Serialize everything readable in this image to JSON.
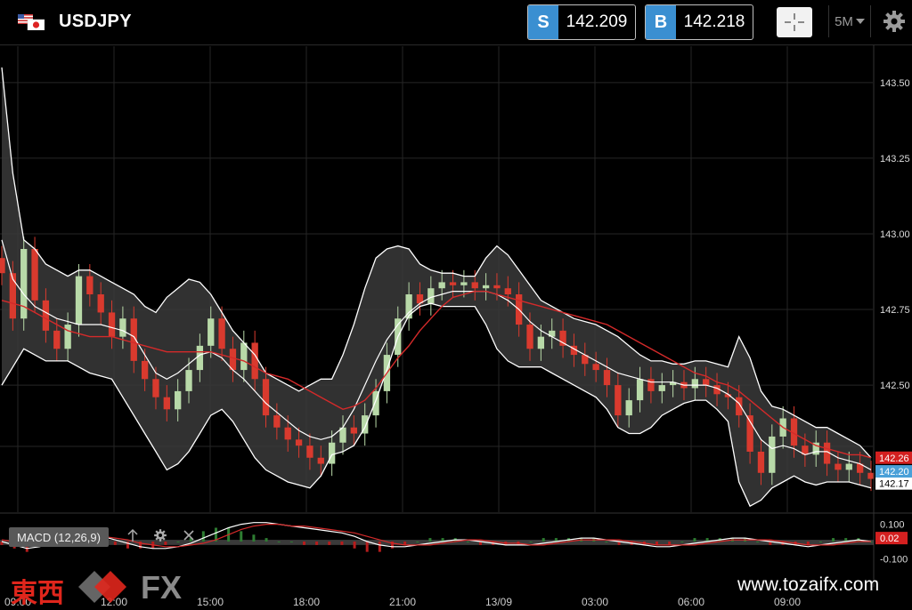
{
  "header": {
    "symbol": "USDJPY",
    "sell_tag": "S",
    "sell_price": "142.209",
    "buy_tag": "B",
    "buy_price": "142.218",
    "timeframe": "5M",
    "timeframe_icon": "caret-down-icon",
    "crosshair_icon": "crosshair-icon",
    "settings_icon": "gear-icon",
    "flag_icon": "us-japan-flag-icon"
  },
  "indicator": {
    "label": "MACD (12,26,9)",
    "up_icon": "arrow-up-icon",
    "settings_icon": "gear-icon",
    "close_icon": "close-icon"
  },
  "branding": {
    "logo_text": "東西",
    "logo_fx": "FX",
    "website": "www.tozaifx.com"
  },
  "colors": {
    "background": "#000000",
    "band_fill": "#3a3a3a",
    "band_line": "#ffffff",
    "ma_line": "#d42a2a",
    "bull_candle": "#b8d9a8",
    "bear_candle": "#d93a2e",
    "sell_badge": "#3a8fd1",
    "last_price_red": "#d42020",
    "last_price_blue": "#4aa0d8"
  },
  "chart_data": [
    {
      "type": "candlestick",
      "symbol": "USDJPY",
      "timeframe": "5M",
      "x_ticks": [
        "09:00",
        "12:00",
        "15:00",
        "18:00",
        "21:00",
        "13/09",
        "03:00",
        "06:00",
        "09:00"
      ],
      "y_ticks": [
        "143.50",
        "143.25",
        "143.00",
        "142.75",
        "142.50"
      ],
      "ylim": [
        142.08,
        143.62
      ],
      "price_labels": [
        {
          "text": "142.26",
          "value": 142.26,
          "color": "red"
        },
        {
          "text": "142.20",
          "value": 142.215,
          "color": "blue"
        },
        {
          "text": "142.17",
          "value": 142.175,
          "color": "white"
        }
      ],
      "overlays": [
        "Bollinger Bands",
        "Moving Average"
      ],
      "close": [
        142.87,
        142.72,
        142.95,
        142.78,
        142.68,
        142.62,
        142.7,
        142.86,
        142.8,
        142.74,
        142.66,
        142.72,
        142.58,
        142.52,
        142.46,
        142.42,
        142.48,
        142.55,
        142.63,
        142.72,
        142.62,
        142.55,
        142.64,
        142.52,
        142.4,
        142.36,
        142.32,
        142.3,
        142.26,
        142.24,
        142.31,
        142.36,
        142.34,
        142.4,
        142.48,
        142.6,
        142.72,
        142.8,
        142.77,
        142.82,
        142.84,
        142.83,
        142.84,
        142.82,
        142.83,
        142.82,
        142.8,
        142.7,
        142.62,
        142.66,
        142.68,
        142.63,
        142.6,
        142.57,
        142.55,
        142.5,
        142.4,
        142.45,
        142.52,
        142.48,
        142.5,
        142.51,
        142.49,
        142.52,
        142.5,
        142.47,
        142.46,
        142.4,
        142.28,
        142.21,
        142.33,
        142.39,
        142.3,
        142.27,
        142.31,
        142.24,
        142.22,
        142.24,
        142.21,
        142.19
      ],
      "bollinger_upper": [
        143.55,
        143.2,
        142.98,
        142.95,
        142.9,
        142.88,
        142.86,
        142.88,
        142.88,
        142.86,
        142.84,
        142.82,
        142.8,
        142.76,
        142.74,
        142.79,
        142.82,
        142.85,
        142.84,
        142.8,
        142.74,
        142.68,
        142.64,
        142.6,
        142.54,
        142.52,
        142.5,
        142.48,
        142.5,
        142.52,
        142.52,
        142.6,
        142.7,
        142.82,
        142.92,
        142.95,
        142.96,
        142.95,
        142.9,
        142.88,
        142.87,
        142.87,
        142.86,
        142.86,
        142.92,
        142.96,
        142.93,
        142.88,
        142.83,
        142.78,
        142.76,
        142.74,
        142.72,
        142.71,
        142.7,
        142.68,
        142.66,
        142.63,
        142.6,
        142.58,
        142.58,
        142.57,
        142.57,
        142.58,
        142.58,
        142.57,
        142.56,
        142.66,
        142.59,
        142.48,
        142.43,
        142.42,
        142.4,
        142.38,
        142.36,
        142.36,
        142.34,
        142.32,
        142.3,
        142.26
      ],
      "bollinger_middle": [
        142.98,
        142.85,
        142.8,
        142.76,
        142.74,
        142.72,
        142.71,
        142.7,
        142.7,
        142.7,
        142.69,
        142.68,
        142.66,
        142.6,
        142.54,
        142.52,
        142.54,
        142.57,
        142.6,
        142.61,
        142.59,
        142.55,
        142.52,
        142.48,
        142.44,
        142.41,
        142.38,
        142.35,
        142.33,
        142.32,
        142.33,
        142.36,
        142.42,
        142.5,
        142.58,
        142.65,
        142.7,
        142.74,
        142.77,
        142.79,
        142.8,
        142.81,
        142.81,
        142.81,
        142.81,
        142.8,
        142.78,
        142.75,
        142.71,
        142.68,
        142.66,
        142.64,
        142.62,
        142.6,
        142.58,
        142.56,
        142.54,
        142.53,
        142.52,
        142.51,
        142.51,
        142.51,
        142.5,
        142.5,
        142.5,
        142.49,
        142.47,
        142.44,
        142.38,
        142.32,
        142.29,
        142.3,
        142.29,
        142.27,
        142.28,
        142.28,
        142.26,
        142.25,
        142.24,
        142.22
      ],
      "bollinger_lower": [
        142.5,
        142.56,
        142.62,
        142.6,
        142.58,
        142.58,
        142.58,
        142.56,
        142.54,
        142.53,
        142.52,
        142.46,
        142.4,
        142.34,
        142.28,
        142.22,
        142.24,
        142.28,
        142.34,
        142.4,
        142.42,
        142.38,
        142.32,
        142.26,
        142.22,
        142.2,
        142.18,
        142.17,
        142.16,
        142.2,
        142.27,
        142.28,
        142.3,
        142.36,
        142.45,
        142.55,
        142.66,
        142.73,
        142.76,
        142.77,
        142.76,
        142.76,
        142.76,
        142.76,
        142.7,
        142.62,
        142.58,
        142.56,
        142.56,
        142.56,
        142.54,
        142.52,
        142.5,
        142.48,
        142.46,
        142.42,
        142.36,
        142.34,
        142.34,
        142.36,
        142.4,
        142.42,
        142.44,
        142.45,
        142.45,
        142.42,
        142.38,
        142.18,
        142.1,
        142.12,
        142.16,
        142.18,
        142.2,
        142.18,
        142.17,
        142.18,
        142.18,
        142.18,
        142.17,
        142.16
      ],
      "moving_average": [
        142.78,
        142.77,
        142.76,
        142.74,
        142.72,
        142.7,
        142.68,
        142.67,
        142.66,
        142.66,
        142.66,
        142.65,
        142.64,
        142.63,
        142.62,
        142.61,
        142.61,
        142.61,
        142.61,
        142.61,
        142.6,
        142.59,
        142.58,
        142.56,
        142.54,
        142.53,
        142.52,
        142.5,
        142.48,
        142.46,
        142.44,
        142.42,
        142.43,
        142.45,
        142.49,
        142.54,
        142.59,
        142.63,
        142.68,
        142.72,
        142.76,
        142.79,
        142.8,
        142.81,
        142.81,
        142.8,
        142.79,
        142.78,
        142.77,
        142.76,
        142.75,
        142.74,
        142.73,
        142.72,
        142.71,
        142.7,
        142.68,
        142.66,
        142.64,
        142.62,
        142.6,
        142.58,
        142.56,
        142.54,
        142.53,
        142.51,
        142.5,
        142.48,
        142.45,
        142.42,
        142.39,
        142.36,
        142.34,
        142.32,
        142.3,
        142.29,
        142.28,
        142.27,
        142.27,
        142.26
      ]
    },
    {
      "type": "macd",
      "label": "MACD (12,26,9)",
      "y_ticks": [
        "0.100",
        "0.02",
        "-0.100"
      ],
      "ylim": [
        -0.16,
        0.16
      ],
      "macd": [
        0.0,
        -0.02,
        -0.04,
        -0.03,
        -0.01,
        0.01,
        0.03,
        0.04,
        0.03,
        0.01,
        -0.01,
        -0.03,
        -0.04,
        -0.04,
        -0.03,
        -0.01,
        0.02,
        0.05,
        0.08,
        0.1,
        0.11,
        0.11,
        0.1,
        0.09,
        0.08,
        0.07,
        0.06,
        0.05,
        0.03,
        0.0,
        -0.02,
        -0.03,
        -0.03,
        -0.02,
        -0.01,
        0.0,
        0.01,
        0.01,
        0.0,
        -0.01,
        -0.02,
        -0.02,
        -0.02,
        -0.01,
        0.0,
        0.01,
        0.02,
        0.02,
        0.01,
        0.0,
        -0.01,
        -0.02,
        -0.03,
        -0.03,
        -0.02,
        -0.01,
        0.0,
        0.01,
        0.02,
        0.02,
        0.01,
        0.0,
        -0.01,
        -0.02,
        -0.03,
        -0.02,
        -0.01,
        0.0,
        0.01,
        0.0
      ],
      "signal": [
        0.01,
        0.0,
        -0.01,
        -0.02,
        -0.02,
        -0.01,
        0.0,
        0.02,
        0.03,
        0.02,
        0.01,
        -0.01,
        -0.02,
        -0.03,
        -0.03,
        -0.02,
        -0.01,
        0.01,
        0.04,
        0.07,
        0.09,
        0.1,
        0.1,
        0.09,
        0.09,
        0.08,
        0.07,
        0.06,
        0.05,
        0.03,
        0.01,
        -0.01,
        -0.02,
        -0.02,
        -0.02,
        -0.01,
        0.0,
        0.01,
        0.01,
        0.0,
        -0.01,
        -0.01,
        -0.02,
        -0.02,
        -0.01,
        0.0,
        0.01,
        0.01,
        0.01,
        0.01,
        0.0,
        -0.01,
        -0.02,
        -0.02,
        -0.02,
        -0.02,
        -0.01,
        0.0,
        0.01,
        0.01,
        0.01,
        0.01,
        0.0,
        -0.01,
        -0.02,
        -0.02,
        -0.02,
        -0.01,
        0.0,
        0.0
      ]
    }
  ]
}
